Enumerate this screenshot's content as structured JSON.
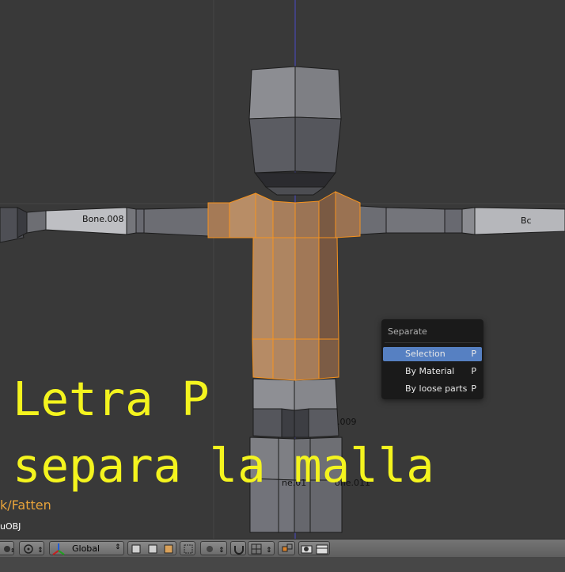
{
  "bones": {
    "bone_008": "Bone.008",
    "bone_right_partial": "Bc",
    "bone_009_partial": ".009",
    "bone_011_partial": "one.011",
    "bone_013_partial": "ne.01"
  },
  "overlay": {
    "line1": "Letra P",
    "line2": "separa la malla",
    "color": "#f4f41e"
  },
  "status": {
    "last_operator": "k/Fatten",
    "object_name": "uOBJ",
    "operator_color": "#e8a33a"
  },
  "separate_menu": {
    "title": "Separate",
    "items": [
      {
        "label": "Selection",
        "shortcut": "P",
        "active": true
      },
      {
        "label": "By Material",
        "shortcut": "P",
        "active": false
      },
      {
        "label": "By loose parts",
        "shortcut": "P",
        "active": false
      }
    ]
  },
  "header": {
    "orientation_label": "Global",
    "icons": [
      "viewport-shading-icon",
      "pivot-point-icon",
      "manipulator-icon",
      "select-mode-vertex-icon",
      "select-mode-edge-icon",
      "select-mode-face-icon",
      "occlude-geometry-icon",
      "proportional-edit-icon",
      "snap-icon",
      "render-camera-icon",
      "render-animation-icon"
    ]
  },
  "colors": {
    "background": "#393939",
    "selection_orange": "#f7931e",
    "menu_highlight": "#5680c2"
  }
}
